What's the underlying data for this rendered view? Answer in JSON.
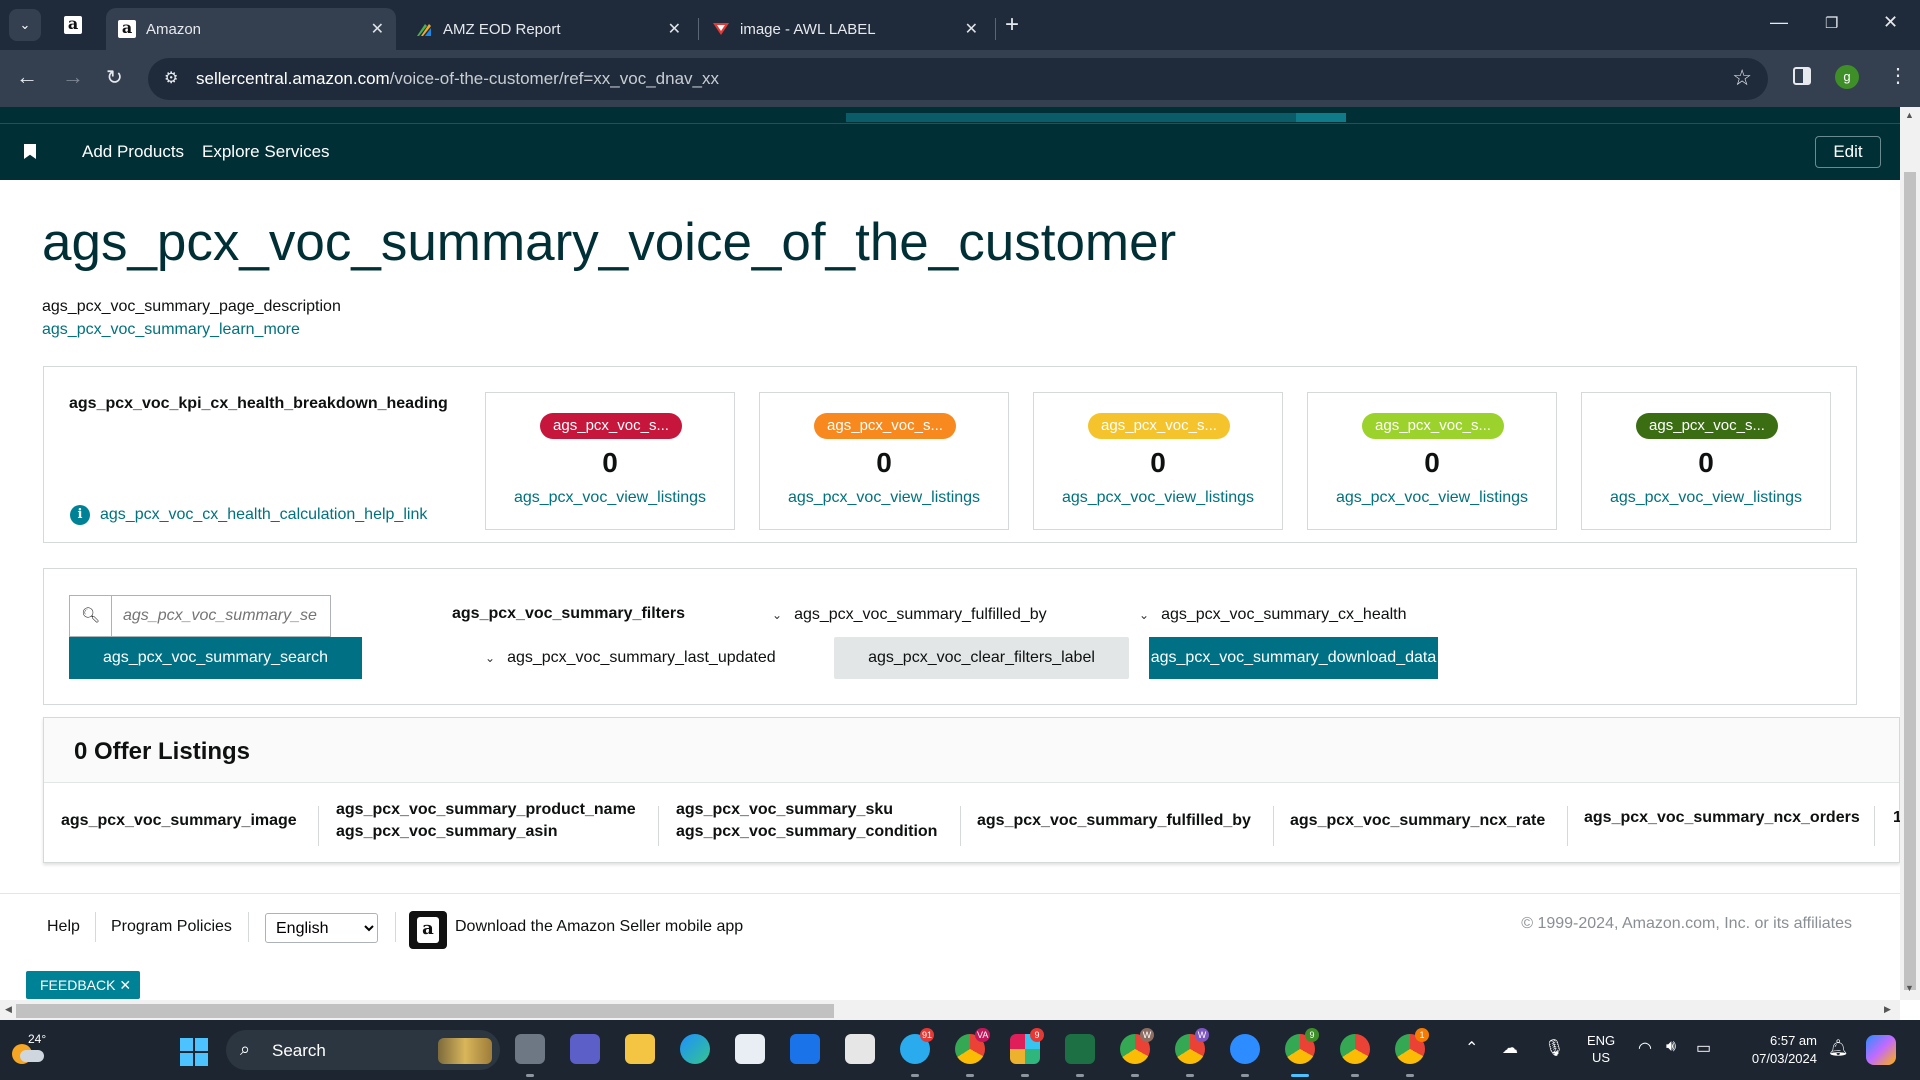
{
  "browser": {
    "tabs": [
      {
        "title": "Amazon",
        "active": true
      },
      {
        "title": "AMZ EOD Report",
        "active": false
      },
      {
        "title": "image - AWL LABEL",
        "active": false
      }
    ],
    "url_main": "sellercentral.amazon.com",
    "url_path": "/voice-of-the-customer/ref=xx_voc_dnav_xx",
    "profile_initial": "g"
  },
  "nav": {
    "links": [
      "Add Products",
      "Explore Services"
    ],
    "edit_label": "Edit"
  },
  "page": {
    "title": "ags_pcx_voc_summary_voice_of_the_customer",
    "description": "ags_pcx_voc_summary_page_description",
    "learn_more": "ags_pcx_voc_summary_learn_more"
  },
  "kpi": {
    "heading": "ags_pcx_voc_kpi_cx_health_breakdown_heading",
    "help_link": "ags_pcx_voc_cx_health_calculation_help_link",
    "cards": [
      {
        "pill": "ags_pcx_voc_s...",
        "color": "#c7163c",
        "value": "0",
        "link": "ags_pcx_voc_view_listings"
      },
      {
        "pill": "ags_pcx_voc_s...",
        "color": "#f7891f",
        "value": "0",
        "link": "ags_pcx_voc_view_listings"
      },
      {
        "pill": "ags_pcx_voc_s...",
        "color": "#f5c32c",
        "value": "0",
        "link": "ags_pcx_voc_view_listings"
      },
      {
        "pill": "ags_pcx_voc_s...",
        "color": "#9bd22b",
        "value": "0",
        "link": "ags_pcx_voc_view_listings"
      },
      {
        "pill": "ags_pcx_voc_s...",
        "color": "#3b6e13",
        "value": "0",
        "link": "ags_pcx_voc_view_listings"
      }
    ]
  },
  "filters": {
    "search_placeholder": "ags_pcx_voc_summary_se",
    "search_button": "ags_pcx_voc_summary_search",
    "filters_label": "ags_pcx_voc_summary_filters",
    "fulfilled_by": "ags_pcx_voc_summary_fulfilled_by",
    "cx_health": "ags_pcx_voc_summary_cx_health",
    "last_updated": "ags_pcx_voc_summary_last_updated",
    "clear_label": "ags_pcx_voc_clear_filters_label",
    "download_label": "ags_pcx_voc_summary_download_data"
  },
  "listings": {
    "title": "0 Offer Listings",
    "columns": {
      "image": "ags_pcx_voc_summary_image",
      "product_name": "ags_pcx_voc_summary_product_name",
      "asin": "ags_pcx_voc_summary_asin",
      "sku": "ags_pcx_voc_summary_sku",
      "condition": "ags_pcx_voc_summary_condition",
      "fulfilled_by": "ags_pcx_voc_summary_fulfilled_by",
      "ncx_rate": "ags_pcx_voc_summary_ncx_rate",
      "ncx_orders": "ags_pcx_voc_summary_ncx_orders",
      "overflow": "1"
    }
  },
  "footer": {
    "help": "Help",
    "policies": "Program Policies",
    "language": "English",
    "app_text": "Download the Amazon Seller mobile app",
    "copyright": "© 1999-2024, Amazon.com, Inc. or its affiliates",
    "feedback": "FEEDBACK ✕"
  },
  "taskbar": {
    "temperature": "24°",
    "search_label": "Search",
    "lang_line1": "ENG",
    "lang_line2": "US",
    "time": "6:57 am",
    "date": "07/03/2024",
    "badges": {
      "telegram": "91",
      "chrome_va": "VA",
      "slack": "9",
      "chrome_w1": "W",
      "chrome_w2": "W",
      "chrome_g": "9",
      "chrome_o": "1"
    }
  }
}
